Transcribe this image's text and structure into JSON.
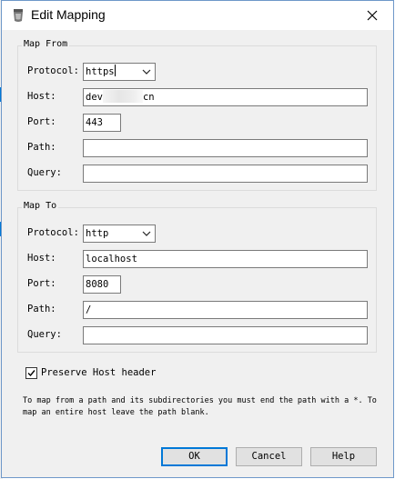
{
  "window": {
    "title": "Edit Mapping"
  },
  "map_from": {
    "legend": "Map From",
    "protocol_label": "Protocol:",
    "protocol_value": "https",
    "host_label": "Host:",
    "host_value_start": "dev",
    "host_value_end": "cn",
    "port_label": "Port:",
    "port_value": "443",
    "path_label": "Path:",
    "path_value": "",
    "query_label": "Query:",
    "query_value": ""
  },
  "map_to": {
    "legend": "Map To",
    "protocol_label": "Protocol:",
    "protocol_value": "http",
    "host_label": "Host:",
    "host_value": "localhost",
    "port_label": "Port:",
    "port_value": "8080",
    "path_label": "Path:",
    "path_value": "/",
    "query_label": "Query:",
    "query_value": ""
  },
  "preserve_host": {
    "label": "Preserve Host header",
    "checked": true
  },
  "info_text": "To map from a path and its subdirectories you must end the path with a *. To map an entire host leave the path blank.",
  "buttons": {
    "ok": "OK",
    "cancel": "Cancel",
    "help": "Help"
  },
  "colors": {
    "accent": "#0078d7",
    "dialog_bg": "#f0f0f0",
    "border": "#7a7a7a"
  },
  "icons": {
    "title": "app-icon",
    "close": "close-icon",
    "dropdown": "chevron-down-icon",
    "check": "checkmark-icon"
  }
}
